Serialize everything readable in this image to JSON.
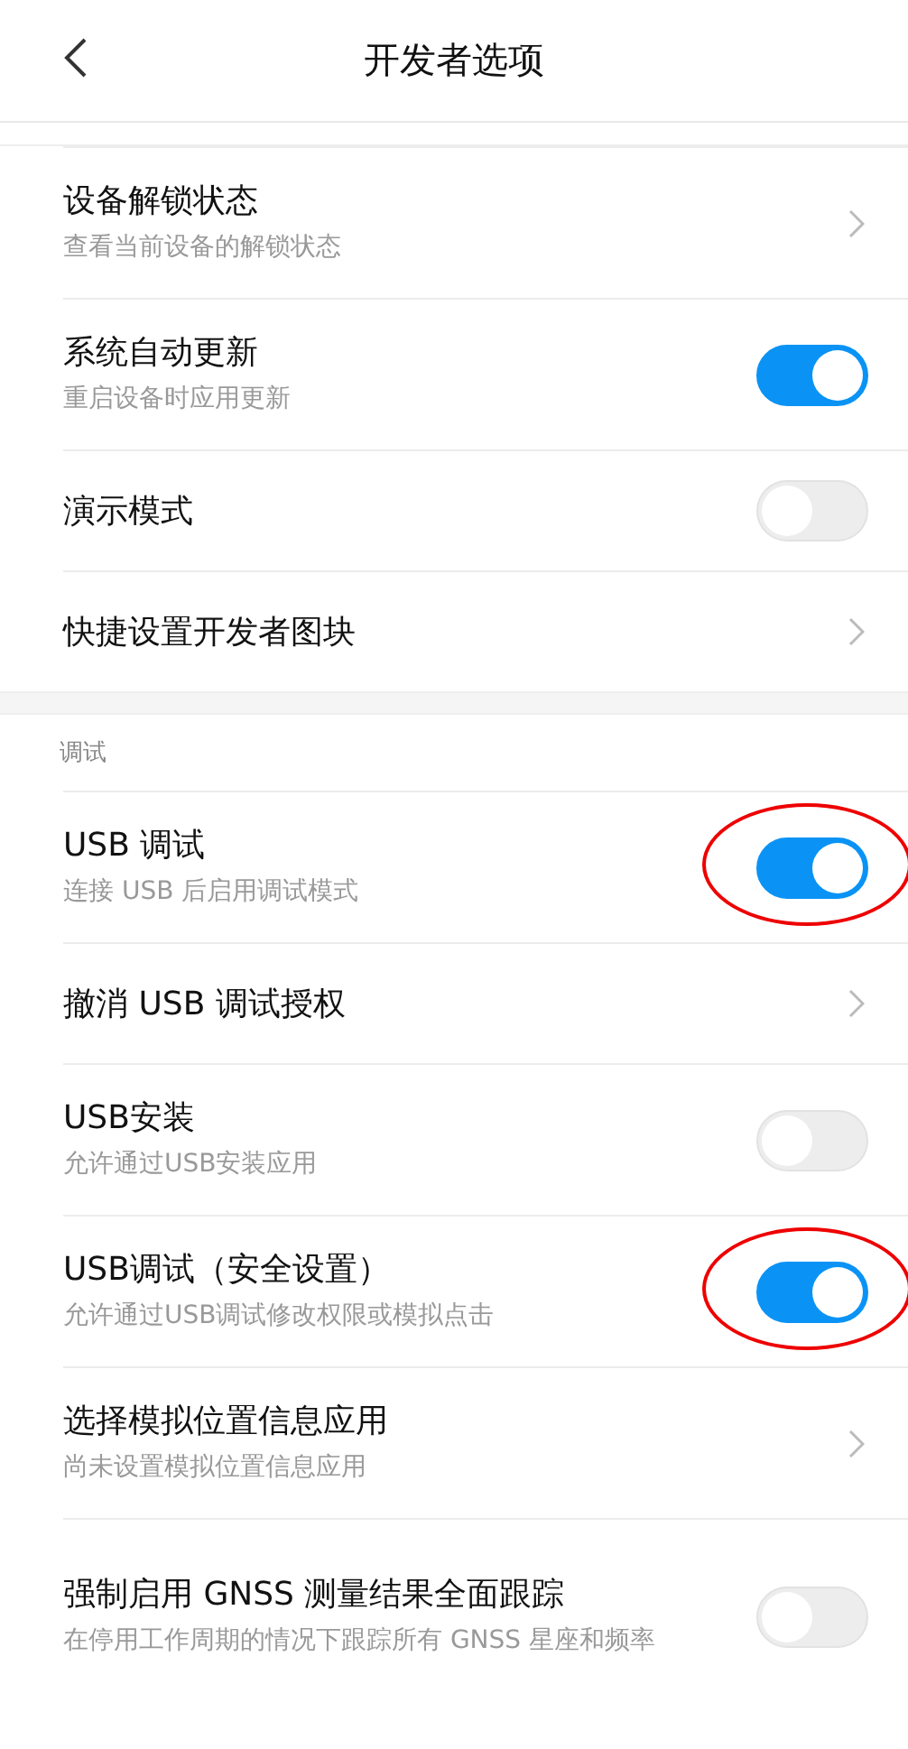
{
  "header": {
    "title": "开发者选项"
  },
  "groups": [
    {
      "items": [
        {
          "kind": "nav",
          "title": "设备解锁状态",
          "subtitle": "查看当前设备的解锁状态"
        },
        {
          "kind": "toggle",
          "title": "系统自动更新",
          "subtitle": "重启设备时应用更新",
          "on": true,
          "circled": false
        },
        {
          "kind": "toggle",
          "title": "演示模式",
          "on": false,
          "circled": false
        },
        {
          "kind": "nav",
          "title": "快捷设置开发者图块"
        }
      ]
    },
    {
      "label": "调试",
      "items": [
        {
          "kind": "toggle",
          "title": "USB 调试",
          "subtitle": "连接 USB 后启用调试模式",
          "on": true,
          "circled": true
        },
        {
          "kind": "nav",
          "title": "撤消 USB 调试授权"
        },
        {
          "kind": "toggle",
          "title": "USB安装",
          "subtitle": "允许通过USB安装应用",
          "on": false,
          "circled": false
        },
        {
          "kind": "toggle",
          "title": "USB调试（安全设置）",
          "subtitle": "允许通过USB调试修改权限或模拟点击",
          "on": true,
          "circled": true
        },
        {
          "kind": "nav",
          "title": "选择模拟位置信息应用",
          "subtitle": "尚未设置模拟位置信息应用"
        },
        {
          "kind": "toggle",
          "title": "强制启用 GNSS 测量结果全面跟踪",
          "subtitle": "在停用工作周期的情况下跟踪所有 GNSS 星座和频率",
          "on": false,
          "circled": false
        }
      ]
    }
  ]
}
